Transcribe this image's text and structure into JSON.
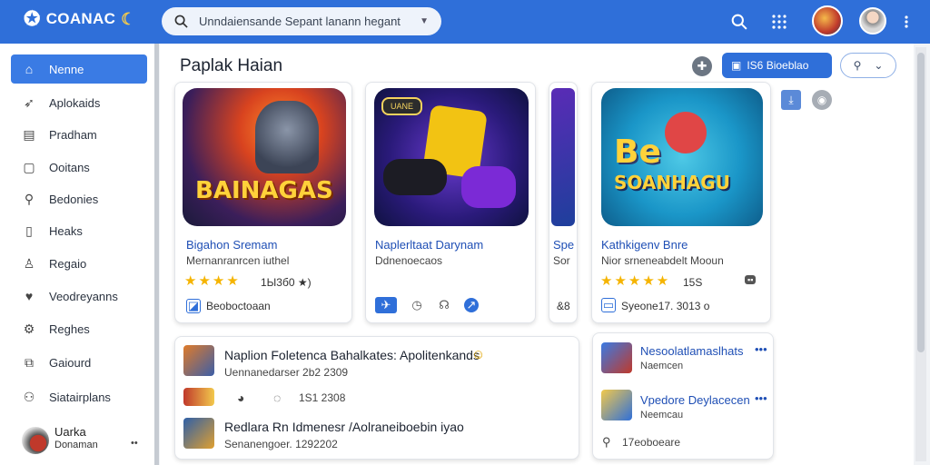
{
  "header": {
    "logo_text": "COANAC",
    "search_value": "Unndaiensande Sepant lanann hegant",
    "icons": [
      "search-icon",
      "apps-grid-icon",
      "more-vert-icon"
    ]
  },
  "sidebar": {
    "items": [
      {
        "label": "Nenne",
        "icon": "home-icon",
        "active": true
      },
      {
        "label": "Aplokaids",
        "icon": "rocket-icon"
      },
      {
        "label": "Pradham",
        "icon": "document-icon"
      },
      {
        "label": "Ooitans",
        "icon": "square-icon"
      },
      {
        "label": "Bedonies",
        "icon": "search-icon"
      },
      {
        "label": "Heaks",
        "icon": "page-icon"
      },
      {
        "label": "Regaio",
        "icon": "person-icon"
      },
      {
        "label": "Veodreyanns",
        "icon": "heart-icon"
      },
      {
        "label": "Reghes",
        "icon": "gear-icon"
      },
      {
        "label": "Gaiourd",
        "icon": "stack-icon"
      },
      {
        "label": "Siatairplans",
        "icon": "user-group-icon"
      }
    ],
    "profile": {
      "name": "Uarka",
      "sub": "Donaman",
      "dots": "••"
    }
  },
  "main": {
    "title": "Paplak Haian",
    "primary_button": "IS6 Bioeblao",
    "cards": [
      {
        "title": "Bigahon Sremam",
        "sub": "Mernanranrcen iuthel",
        "rating": "1Ы3б0 ★)",
        "action": "Beoboctoaan",
        "art_text": "BAINAGAS"
      },
      {
        "title": "Naplerltaat Darynam",
        "sub": "Ddnenoecaos",
        "art_tag": "UANE"
      },
      {
        "title": "Spe",
        "sub": "Sor",
        "rating": "&8"
      },
      {
        "title": "Kathkigenv Bnre",
        "sub": "Nior srneneabdelt Mooun",
        "rating": "15S",
        "meta": "Syeone17. 3013 o",
        "art_big": "Be",
        "art_text": "SOANHAGU"
      }
    ],
    "feed": [
      {
        "title": "Naplion Foletenca Bahalkates: Apolitenkands",
        "meta": "Uennanedarser 2b2 2309"
      },
      {
        "meta": "1S1 2308"
      },
      {
        "title": "Redlara Rn Idmenesr /Aolraneiboebin iyao",
        "meta": "Senanengoer. 1292202"
      }
    ],
    "side_list": [
      {
        "title": "Nesoolatlamaslhats",
        "sub": "Naemcen"
      },
      {
        "title": "Vpedore Deylacecen",
        "sub": "Neemcau"
      },
      {
        "meta": "17eoboeare"
      }
    ]
  },
  "colors": {
    "accent": "#2f6fd9",
    "star": "#f5b400",
    "link": "#1f4fb5"
  }
}
